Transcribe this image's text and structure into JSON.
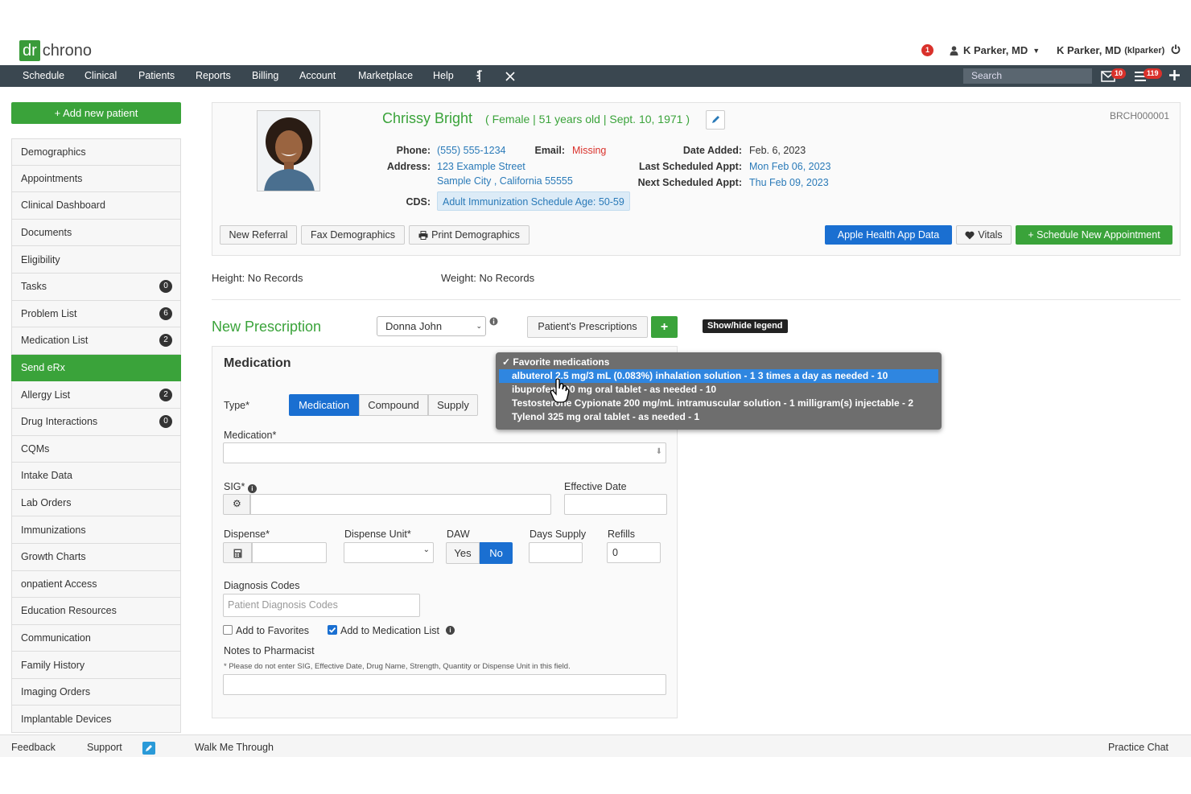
{
  "app": {
    "logo_dr": "dr",
    "logo_chrono": "chrono"
  },
  "topright": {
    "alert_count": "1",
    "user_menu": "K Parker, MD",
    "user_full": "K Parker, MD",
    "user_handle": "(klparker)"
  },
  "nav": {
    "items": [
      "Schedule",
      "Clinical",
      "Patients",
      "Reports",
      "Billing",
      "Account",
      "Marketplace",
      "Help"
    ],
    "search_placeholder": "Search",
    "mail_count": "10",
    "tasks_count": "119"
  },
  "sidebar": {
    "add_patient": "+ Add new patient",
    "items": [
      {
        "label": "Demographics",
        "count": null
      },
      {
        "label": "Appointments",
        "count": null
      },
      {
        "label": "Clinical Dashboard",
        "count": null
      },
      {
        "label": "Documents",
        "count": null
      },
      {
        "label": "Eligibility",
        "count": null
      },
      {
        "label": "Tasks",
        "count": "0"
      },
      {
        "label": "Problem List",
        "count": "6"
      },
      {
        "label": "Medication List",
        "count": "2"
      },
      {
        "label": "Send eRx",
        "count": null,
        "active": true
      },
      {
        "label": "Allergy List",
        "count": "2"
      },
      {
        "label": "Drug Interactions",
        "count": "0"
      },
      {
        "label": "CQMs",
        "count": null
      },
      {
        "label": "Intake Data",
        "count": null
      },
      {
        "label": "Lab Orders",
        "count": null
      },
      {
        "label": "Immunizations",
        "count": null
      },
      {
        "label": "Growth Charts",
        "count": null
      },
      {
        "label": "onpatient Access",
        "count": null
      },
      {
        "label": "Education Resources",
        "count": null
      },
      {
        "label": "Communication",
        "count": null
      },
      {
        "label": "Family History",
        "count": null
      },
      {
        "label": "Imaging Orders",
        "count": null
      },
      {
        "label": "Implantable Devices",
        "count": null
      }
    ]
  },
  "patient": {
    "name": "Chrissy Bright",
    "sex": "Female",
    "age": "51 years old",
    "dob": "Sept. 10, 1971",
    "chart_id": "BRCH000001",
    "phone_label": "Phone:",
    "phone": "(555) 555-1234",
    "email_label": "Email:",
    "email": "Missing",
    "address_label": "Address:",
    "address1": "123 Example Street",
    "address2": "Sample City , California 55555",
    "cds_label": "CDS:",
    "cds": "Adult Immunization Schedule Age: 50-59",
    "date_added_label": "Date Added:",
    "date_added": "Feb. 6, 2023",
    "last_appt_label": "Last Scheduled Appt:",
    "last_appt": "Mon Feb 06, 2023",
    "next_appt_label": "Next Scheduled Appt:",
    "next_appt": "Thu Feb 09, 2023"
  },
  "patient_actions": {
    "new_referral": "New Referral",
    "fax_demographics": "Fax Demographics",
    "print_demographics": "Print Demographics",
    "apple_health": "Apple Health App Data",
    "vitals": "Vitals",
    "schedule_new": "+ Schedule New Appointment"
  },
  "vitals": {
    "height": "Height: No Records",
    "weight": "Weight: No Records"
  },
  "prescription": {
    "title": "New Prescription",
    "prescriber": "Donna John",
    "patients_prescriptions": "Patient's Prescriptions",
    "add": "+",
    "legend": "Show/hide legend"
  },
  "medication_form": {
    "heading": "Medication",
    "type_label": "Type*",
    "types": [
      "Medication",
      "Compound",
      "Supply"
    ],
    "medication_label": "Medication*",
    "sig_label": "SIG*",
    "effective_date_label": "Effective Date",
    "dispense_label": "Dispense*",
    "dispense_unit_label": "Dispense Unit*",
    "daw_label": "DAW",
    "daw_yes": "Yes",
    "daw_no": "No",
    "days_supply_label": "Days Supply",
    "refills_label": "Refills",
    "refills_value": "0",
    "diagnosis_label": "Diagnosis Codes",
    "diagnosis_placeholder": "Patient Diagnosis Codes",
    "add_favorites": "Add to Favorites",
    "add_med_list": "Add to Medication List",
    "notes_label": "Notes to Pharmacist",
    "notes_hint": "* Please do not enter SIG, Effective Date, Drug Name, Strength, Quantity or Dispense Unit in this field."
  },
  "favorites_dropdown": {
    "header": "✓ Favorite medications",
    "options": [
      "albuterol 2.5 mg/3 mL (0.083%) inhalation solution - 1 3 times a day as needed - 10",
      "ibuprofen 800 mg oral tablet - as needed - 10",
      "Testosterone Cypionate 200 mg/mL intramuscular solution - 1 milligram(s) injectable - 2",
      "Tylenol 325 mg oral tablet - as needed - 1"
    ],
    "selected_index": 0
  },
  "footer": {
    "feedback": "Feedback",
    "support": "Support",
    "walk_me": "Walk Me Through",
    "practice_chat": "Practice Chat"
  },
  "colors": {
    "nav": "#3a4750",
    "green": "#3aa33a",
    "blue": "#1a6fd1",
    "link": "#2a7ab8"
  }
}
